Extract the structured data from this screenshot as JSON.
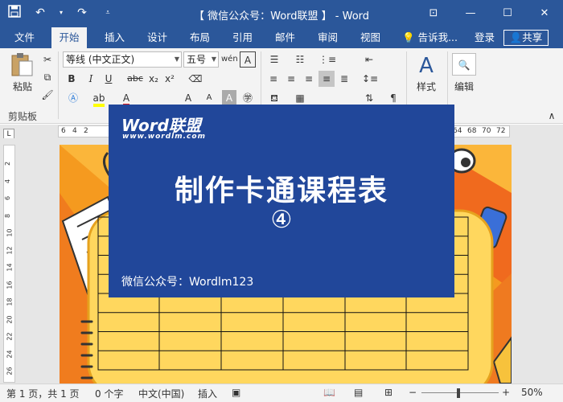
{
  "titlebar": {
    "title": "【 微信公众号：Word联盟 】 - Word",
    "qat_icons": [
      "save-icon",
      "undo-icon",
      "redo-icon",
      "customize-icon"
    ],
    "window_buttons": [
      "ribbon-display-icon",
      "minimize-icon",
      "maximize-icon",
      "close-icon"
    ]
  },
  "tabs": {
    "items": [
      "文件",
      "开始",
      "插入",
      "设计",
      "布局",
      "引用",
      "邮件",
      "审阅",
      "视图"
    ],
    "active": "开始",
    "tell_me": "告诉我...",
    "login": "登录",
    "share": "共享"
  },
  "ribbon": {
    "clipboard": {
      "paste": "粘贴",
      "group": "剪贴板"
    },
    "font": {
      "family": "等线 (中文正文)",
      "size": "五号",
      "bold": "B",
      "italic": "I",
      "underline": "U",
      "strike": "abc",
      "subscript": "x₂",
      "superscript": "x²",
      "font_color": "A",
      "grow": "A",
      "shrink": "A"
    },
    "styles": {
      "label": "样式"
    },
    "editing": {
      "label": "编辑"
    }
  },
  "ruler": {
    "left_ticks": [
      "6",
      "4",
      "2"
    ],
    "right_ticks": [
      "64",
      "68",
      "70",
      "72"
    ]
  },
  "vruler": {
    "ticks": [
      "2",
      "4",
      "6",
      "8",
      "10",
      "12",
      "14",
      "16",
      "18",
      "20",
      "22",
      "24",
      "26"
    ]
  },
  "overlay": {
    "brand": "Word联盟",
    "brand_url": "www.wordlm.com",
    "headline": "制作卡通课程表",
    "number": "④",
    "wechat": "微信公众号：Wordlm123"
  },
  "statusbar": {
    "page": "第 1 页，共 1 页",
    "words": "0 个字",
    "language": "中文(中国)",
    "mode": "插入",
    "zoom": "50%"
  },
  "colors": {
    "word_blue": "#2b579a",
    "card_blue": "#21479a",
    "page_orange": "#f59a1f",
    "notepad_yellow": "#ffd75e"
  }
}
